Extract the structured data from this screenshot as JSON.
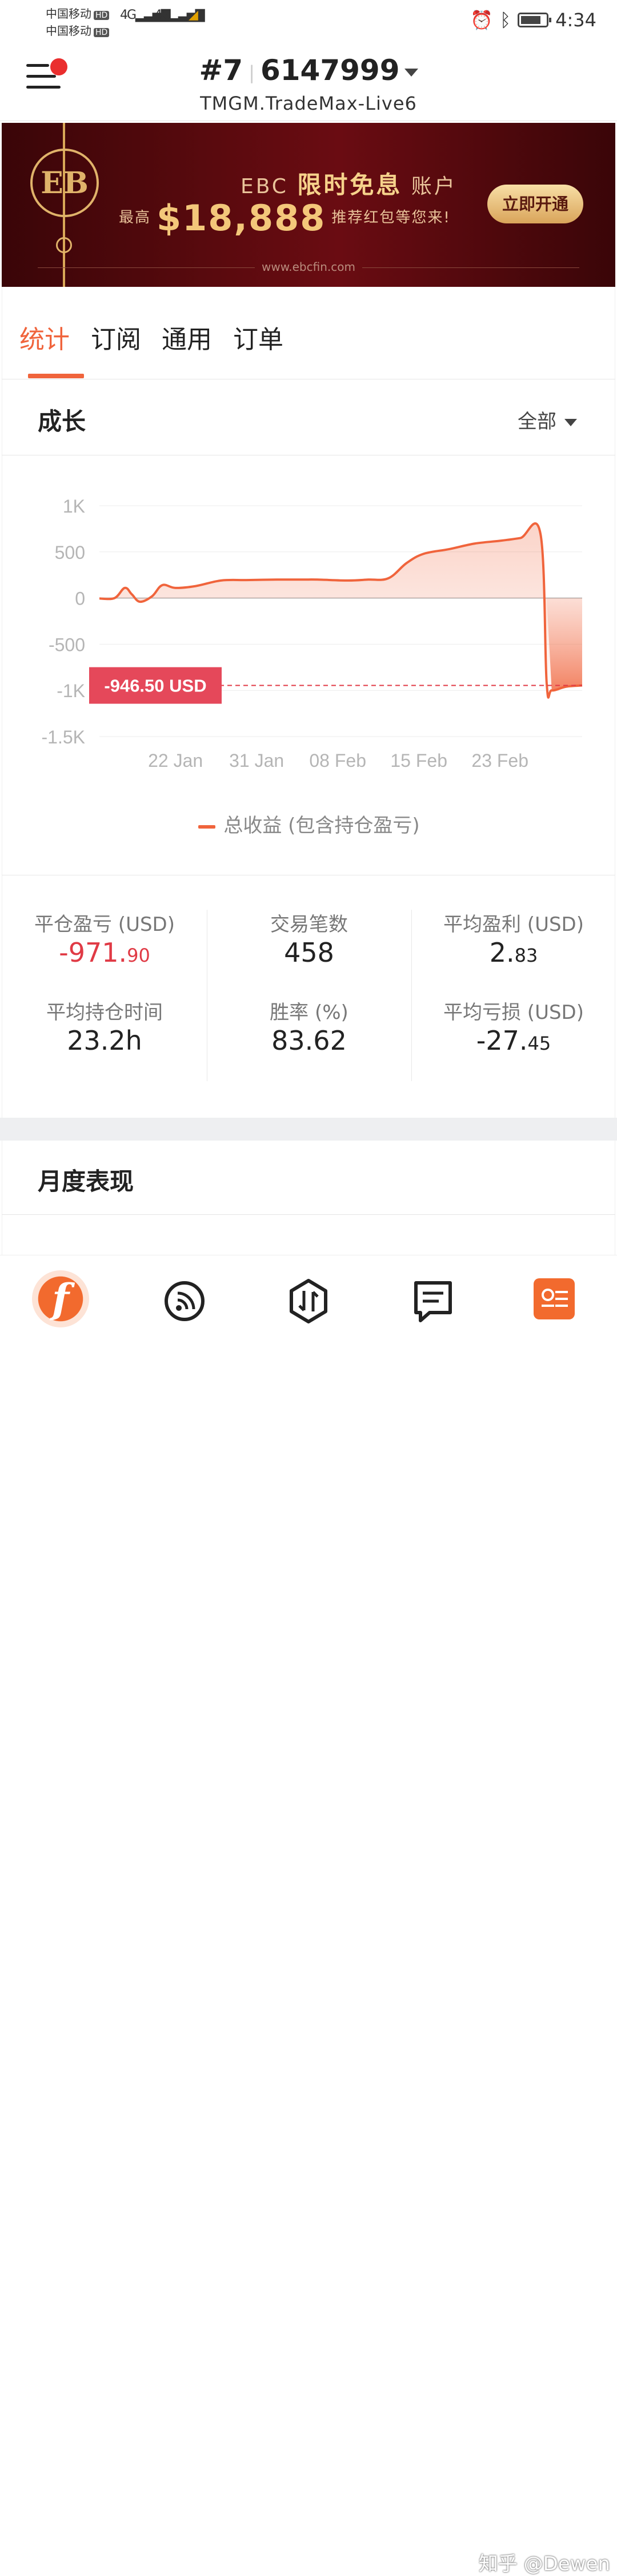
{
  "status_bar": {
    "carrier1": "中国移动",
    "carrier2": "中国移动",
    "hd": "HD",
    "network": "4G",
    "time": "4:34"
  },
  "header": {
    "account_index": "#7",
    "account_number": "6147999",
    "server": "TMGM.TradeMax-Live6"
  },
  "banner": {
    "logo_text": "EB",
    "brand": "EBC",
    "headline_bold": "限时免息",
    "headline_suffix": "账户",
    "prefix": "最高",
    "amount": "$18,888",
    "suffix": "推荐红包等您来!",
    "cta": "立即开通",
    "url": "www.ebcfin.com"
  },
  "tabs": [
    "统计",
    "订阅",
    "通用",
    "订单"
  ],
  "growth": {
    "title": "成长",
    "range": "全部"
  },
  "chart_data": {
    "type": "area",
    "y_tick_labels": [
      "1K",
      "500",
      "0",
      "-500",
      "-1K",
      "-1.5K"
    ],
    "y_ticks": [
      1000,
      500,
      0,
      -500,
      -1000,
      -1500
    ],
    "ylim": [
      -1500,
      1000
    ],
    "x_tick_labels": [
      "22 Jan",
      "31 Jan",
      "08 Feb",
      "15 Feb",
      "23 Feb"
    ],
    "current_label": "-946.50 USD",
    "current_value": -946.5,
    "series": [
      {
        "name": "总收益 (包含持仓盈亏)",
        "points": [
          [
            0,
            -5
          ],
          [
            1.5,
            0
          ],
          [
            2.5,
            110
          ],
          [
            3.2,
            40
          ],
          [
            4.0,
            -40
          ],
          [
            5.2,
            20
          ],
          [
            6.2,
            140
          ],
          [
            7.5,
            110
          ],
          [
            9.5,
            130
          ],
          [
            12,
            190
          ],
          [
            14.5,
            195
          ],
          [
            17.5,
            200
          ],
          [
            20,
            200
          ],
          [
            21.5,
            200
          ],
          [
            24.5,
            190
          ],
          [
            26.5,
            200
          ],
          [
            28.5,
            215
          ],
          [
            30.3,
            380
          ],
          [
            32,
            480
          ],
          [
            34.5,
            530
          ],
          [
            37,
            590
          ],
          [
            39.5,
            620
          ],
          [
            41.5,
            650
          ],
          [
            43.5,
            690
          ],
          [
            44.1,
            -920
          ],
          [
            44.6,
            -1000
          ],
          [
            46,
            -960
          ],
          [
            47.6,
            -946.5
          ]
        ]
      }
    ]
  },
  "stats": [
    {
      "label": "平仓盈亏 (USD)",
      "value_main": "-971.",
      "value_small": "90",
      "negative": true
    },
    {
      "label": "交易笔数",
      "value_main": "458",
      "value_small": "",
      "negative": false
    },
    {
      "label": "平均盈利 (USD)",
      "value_main": "2.",
      "value_small": "83",
      "negative": false
    },
    {
      "label": "平均持仓时间",
      "value_main": "23.2h",
      "value_small": "",
      "negative": false
    },
    {
      "label": "胜率 (%)",
      "value_main": "83.62",
      "value_small": "",
      "negative": false
    },
    {
      "label": "平均亏损 (USD)",
      "value_main": "-27.",
      "value_small": "45",
      "negative": false
    }
  ],
  "monthly": {
    "title": "月度表现"
  },
  "nav": {
    "home_glyph": "f",
    "items": [
      "home-icon",
      "feed-icon",
      "trade-icon",
      "message-icon",
      "profile-icon"
    ]
  },
  "watermark": "知乎 @Dewen",
  "colors": {
    "accent": "#f0643c",
    "negative": "#e03a45",
    "banner_bg": "#5a0a0e"
  }
}
